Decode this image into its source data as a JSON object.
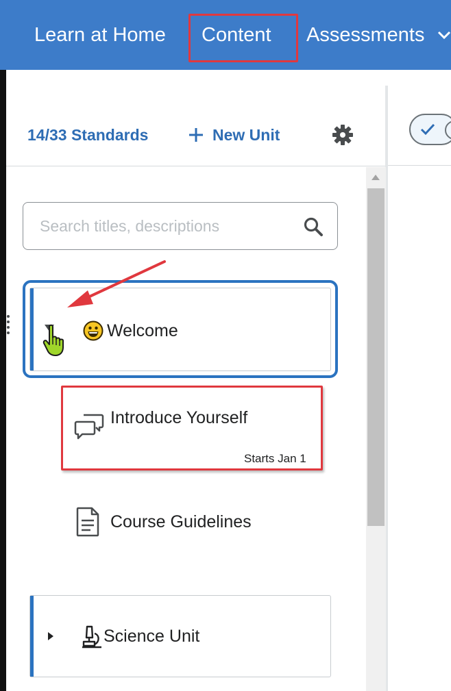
{
  "nav": {
    "items": [
      {
        "label": "Learn at Home"
      },
      {
        "label": "Content"
      },
      {
        "label": "Assessments"
      }
    ]
  },
  "panel": {
    "standards_label": "14/33 Standards",
    "new_unit_label": "New Unit",
    "search_placeholder": "Search titles, descriptions"
  },
  "units": [
    {
      "title": "Welcome",
      "expanded": true,
      "items": [
        {
          "title": "Introduce Yourself",
          "type": "discussion",
          "meta": "Starts Jan 1"
        },
        {
          "title": "Course Guidelines",
          "type": "document"
        }
      ]
    },
    {
      "title": "Science Unit",
      "expanded": false
    }
  ],
  "icons": {
    "settings": "gear-icon",
    "search": "search-icon",
    "add": "plus-icon",
    "welcome_emoji": "smiley-icon",
    "discussion": "discussion-icon",
    "document": "document-icon",
    "science": "microscope-icon",
    "cursor": "hand-pointer-icon",
    "annotation": "red-arrow-icon"
  },
  "colors": {
    "nav_bg": "#3d7cc9",
    "accent": "#2e6db4",
    "unit_bar": "#2b73c0",
    "annotation": "#e0383e",
    "cursor": "#9fd62a"
  }
}
